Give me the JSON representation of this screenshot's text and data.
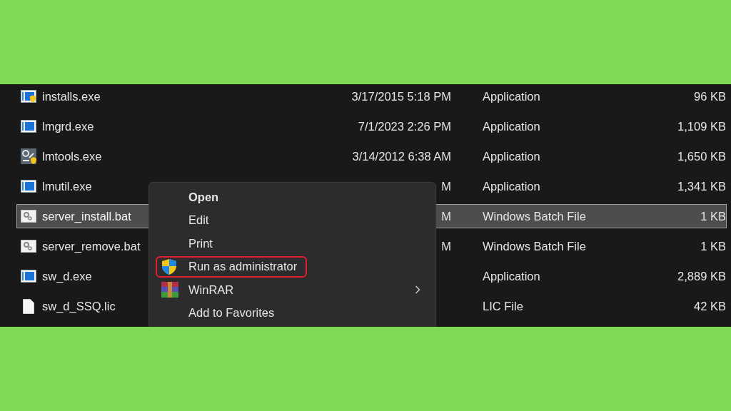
{
  "files": [
    {
      "name": "installs.exe",
      "kind": "app-shield",
      "date": "3/17/2015 5:18 PM",
      "type": "Application",
      "size": "96 KB",
      "selected": false
    },
    {
      "name": "lmgrd.exe",
      "kind": "app",
      "date": "7/1/2023 2:26 PM",
      "type": "Application",
      "size": "1,109 KB",
      "selected": false
    },
    {
      "name": "lmtools.exe",
      "kind": "tools",
      "date": "3/14/2012 6:38 AM",
      "type": "Application",
      "size": "1,650 KB",
      "selected": false
    },
    {
      "name": "lmutil.exe",
      "kind": "app",
      "date": "M",
      "type": "Application",
      "size": "1,341 KB",
      "selected": false
    },
    {
      "name": "server_install.bat",
      "kind": "batch",
      "date": "M",
      "type": "Windows Batch File",
      "size": "1 KB",
      "selected": true
    },
    {
      "name": "server_remove.bat",
      "kind": "batch",
      "date": "M",
      "type": "Windows Batch File",
      "size": "1 KB",
      "selected": false
    },
    {
      "name": "sw_d.exe",
      "kind": "app",
      "type": "Application",
      "size": "2,889 KB",
      "selected": false
    },
    {
      "name": "sw_d_SSQ.lic",
      "kind": "document",
      "type": "LIC File",
      "size": "42 KB",
      "selected": false
    }
  ],
  "context_menu": {
    "items": [
      {
        "label": "Open",
        "default": true,
        "highlighted": false,
        "submenu": false
      },
      {
        "label": "Edit",
        "default": false,
        "highlighted": false,
        "submenu": false
      },
      {
        "label": "Print",
        "default": false,
        "highlighted": false,
        "submenu": false
      },
      {
        "label": "Run as administrator",
        "kind": "admin",
        "default": false,
        "highlighted": true,
        "submenu": false
      },
      {
        "label": "WinRAR",
        "kind": "archive",
        "default": false,
        "highlighted": false,
        "submenu": true
      },
      {
        "label": "Add to Favorites",
        "default": false,
        "highlighted": false,
        "submenu": false
      }
    ]
  }
}
